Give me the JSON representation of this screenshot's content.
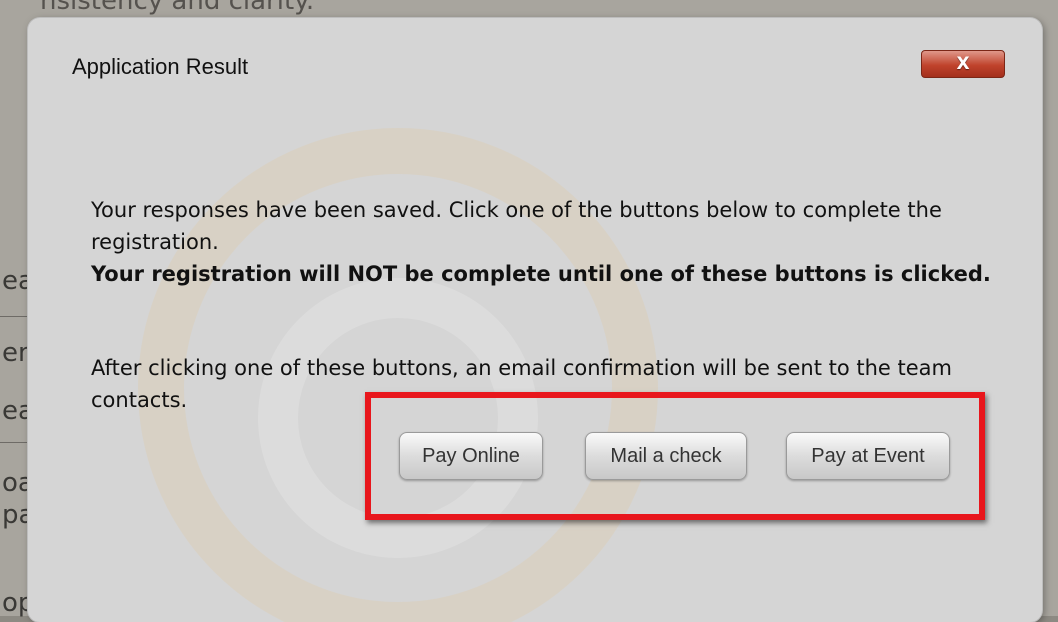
{
  "background": {
    "top_text": "nsistency and clarity.",
    "side_fragments": [
      "ea",
      "en",
      "ea",
      "oa",
      "pa",
      "op"
    ]
  },
  "dialog": {
    "title": "Application Result",
    "close_label": "X",
    "message_line1": "Your responses have been saved. Click one of the buttons below to complete the registration.",
    "message_warning": "Your registration will NOT be complete until one of these buttons is clicked.",
    "message_line2": "After clicking one of these buttons, an email confirmation will be sent to the team contacts.",
    "buttons": {
      "pay_online": "Pay Online",
      "mail_check": "Mail a check",
      "pay_event": "Pay at Event"
    }
  },
  "colors": {
    "highlight_border": "#e8161c",
    "close_button": "#c0432c",
    "dialog_background": "#d5d5d5"
  }
}
